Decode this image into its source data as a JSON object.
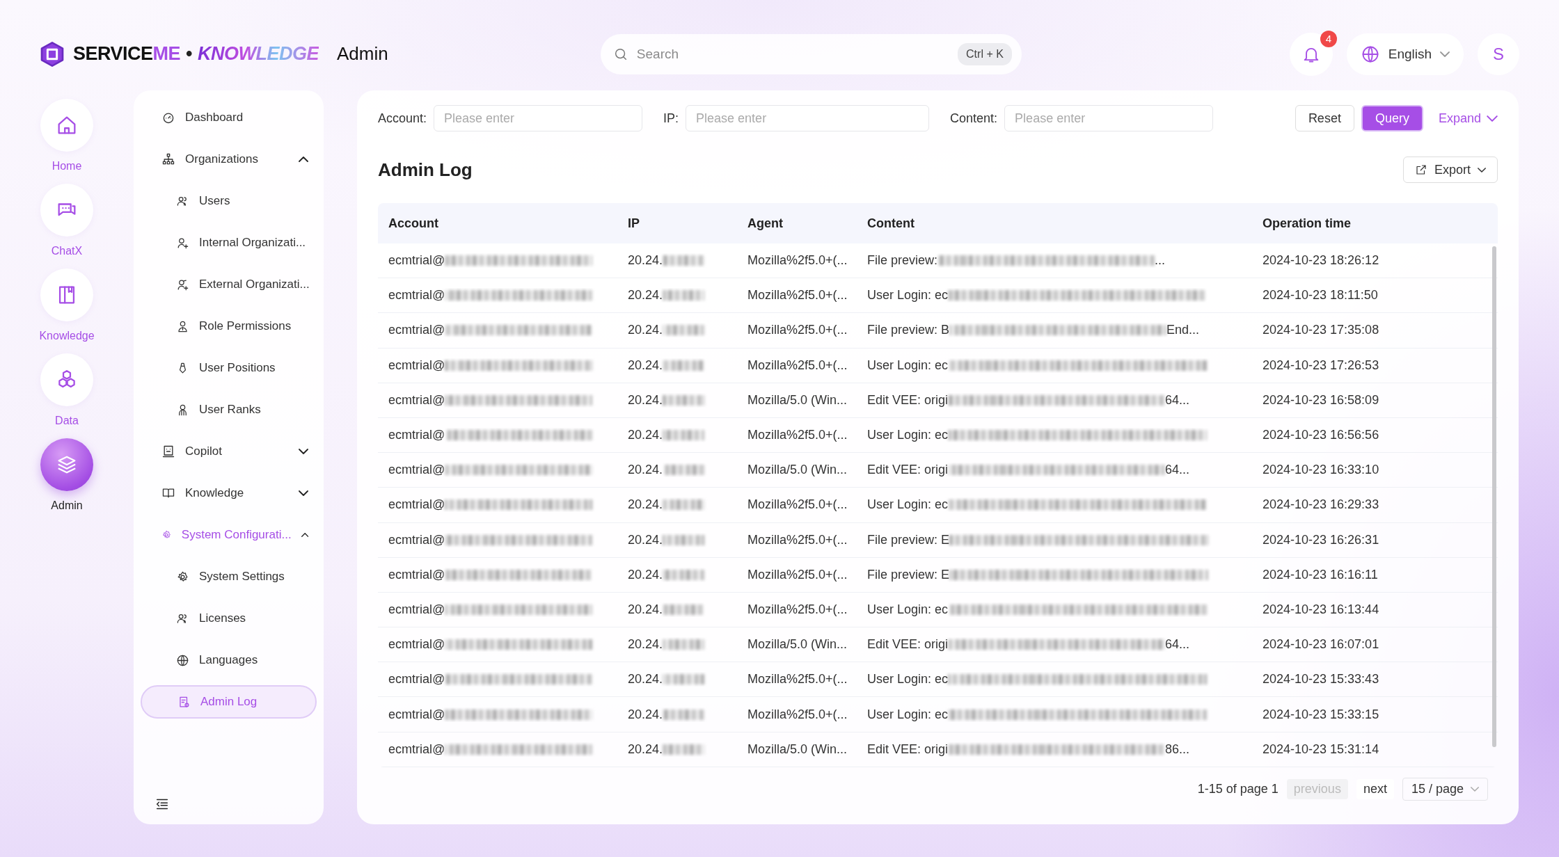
{
  "header": {
    "logo_parts": [
      "SERVICE",
      "ME",
      "•",
      "KNOWLEDGE"
    ],
    "section": "Admin",
    "search": {
      "placeholder": "Search",
      "shortcut": "Ctrl + K"
    },
    "notifications": "4",
    "language": "English",
    "avatar": "S"
  },
  "rail": [
    {
      "label": "Home",
      "selected": false
    },
    {
      "label": "ChatX",
      "selected": false
    },
    {
      "label": "Knowledge",
      "selected": false
    },
    {
      "label": "Data",
      "selected": false
    },
    {
      "label": "Admin",
      "selected": true
    }
  ],
  "sidebar": {
    "items": [
      {
        "label": "Dashboard",
        "selected": false
      },
      {
        "label": "Organizations",
        "expanded": true,
        "children": [
          {
            "label": "Users",
            "selected": false
          },
          {
            "label": "Internal Organizati...",
            "selected": false
          },
          {
            "label": "External Organizati...",
            "selected": false
          },
          {
            "label": "Role Permissions",
            "selected": false
          },
          {
            "label": "User Positions",
            "selected": false
          },
          {
            "label": "User Ranks",
            "selected": false
          }
        ]
      },
      {
        "label": "Copilot",
        "expanded": false
      },
      {
        "label": "Knowledge",
        "expanded": false
      },
      {
        "label": "System Configurati...",
        "expanded": true,
        "children": [
          {
            "label": "System Settings",
            "selected": false
          },
          {
            "label": "Licenses",
            "selected": false
          },
          {
            "label": "Languages",
            "selected": false
          },
          {
            "label": "Admin Log",
            "selected": true
          }
        ]
      }
    ]
  },
  "filters": [
    {
      "label": "Account:",
      "placeholder": "Please enter"
    },
    {
      "label": "IP:",
      "placeholder": "Please enter"
    },
    {
      "label": "Content:",
      "placeholder": "Please enter"
    }
  ],
  "actions": {
    "reset": "Reset",
    "query": "Query",
    "expand": "Expand"
  },
  "title": "Admin Log",
  "export": "Export",
  "table": {
    "columns": [
      "Account",
      "IP",
      "Agent",
      "Content",
      "Operation time"
    ],
    "rows": [
      {
        "account": "ecmtrial@",
        "ip": "20.24.",
        "agent": "Mozilla%2f5.0+(...",
        "content": "File preview: ",
        "content_end": "...",
        "time": "2024-10-23 18:26:12"
      },
      {
        "account": "ecmtrial@",
        "ip": "20.24.",
        "agent": "Mozilla%2f5.0+(...",
        "content": "User Login: ec",
        "time": "2024-10-23 18:11:50"
      },
      {
        "account": "ecmtrial@",
        "ip": "20.24.",
        "agent": "Mozilla%2f5.0+(...",
        "content": "File preview: B",
        "content_end": "End...",
        "time": "2024-10-23 17:35:08"
      },
      {
        "account": "ecmtrial@",
        "ip": "20.24.",
        "agent": "Mozilla%2f5.0+(...",
        "content": "User Login: ec",
        "time": "2024-10-23 17:26:53"
      },
      {
        "account": "ecmtrial@",
        "ip": "20.24.",
        "agent": "Mozilla/5.0 (Win...",
        "content": "Edit VEE: origi",
        "content_end": "64...",
        "time": "2024-10-23 16:58:09"
      },
      {
        "account": "ecmtrial@",
        "ip": "20.24.",
        "agent": "Mozilla%2f5.0+(...",
        "content": "User Login: ec",
        "time": "2024-10-23 16:56:56"
      },
      {
        "account": "ecmtrial@",
        "ip": "20.24.",
        "agent": "Mozilla/5.0 (Win...",
        "content": "Edit VEE: origi",
        "content_end": "64...",
        "time": "2024-10-23 16:33:10"
      },
      {
        "account": "ecmtrial@",
        "ip": "20.24.",
        "agent": "Mozilla%2f5.0+(...",
        "content": "User Login: ec",
        "time": "2024-10-23 16:29:33"
      },
      {
        "account": "ecmtrial@",
        "ip": "20.24.",
        "agent": "Mozilla%2f5.0+(...",
        "content": "File preview: E",
        "time": "2024-10-23 16:26:31"
      },
      {
        "account": "ecmtrial@",
        "ip": "20.24.",
        "agent": "Mozilla%2f5.0+(...",
        "content": "File preview: E",
        "time": "2024-10-23 16:16:11"
      },
      {
        "account": "ecmtrial@",
        "ip": "20.24.",
        "agent": "Mozilla%2f5.0+(...",
        "content": "User Login: ec",
        "time": "2024-10-23 16:13:44"
      },
      {
        "account": "ecmtrial@",
        "ip": "20.24.",
        "agent": "Mozilla/5.0 (Win...",
        "content": "Edit VEE: origi",
        "content_end": "64...",
        "time": "2024-10-23 16:07:01"
      },
      {
        "account": "ecmtrial@",
        "ip": "20.24.",
        "agent": "Mozilla%2f5.0+(...",
        "content": "User Login: ec",
        "time": "2024-10-23 15:33:43"
      },
      {
        "account": "ecmtrial@",
        "ip": "20.24.",
        "agent": "Mozilla%2f5.0+(...",
        "content": "User Login: ec",
        "time": "2024-10-23 15:33:15"
      },
      {
        "account": "ecmtrial@",
        "ip": "20.24.",
        "agent": "Mozilla/5.0 (Win...",
        "content": "Edit VEE: origi",
        "content_end": "86...",
        "time": "2024-10-23 15:31:14"
      }
    ]
  },
  "pagination": {
    "summary": "1-15 of page 1",
    "previous": {
      "label": "previous",
      "disabled": true
    },
    "next": {
      "label": "next",
      "disabled": false
    },
    "page_size": "15 / page"
  }
}
